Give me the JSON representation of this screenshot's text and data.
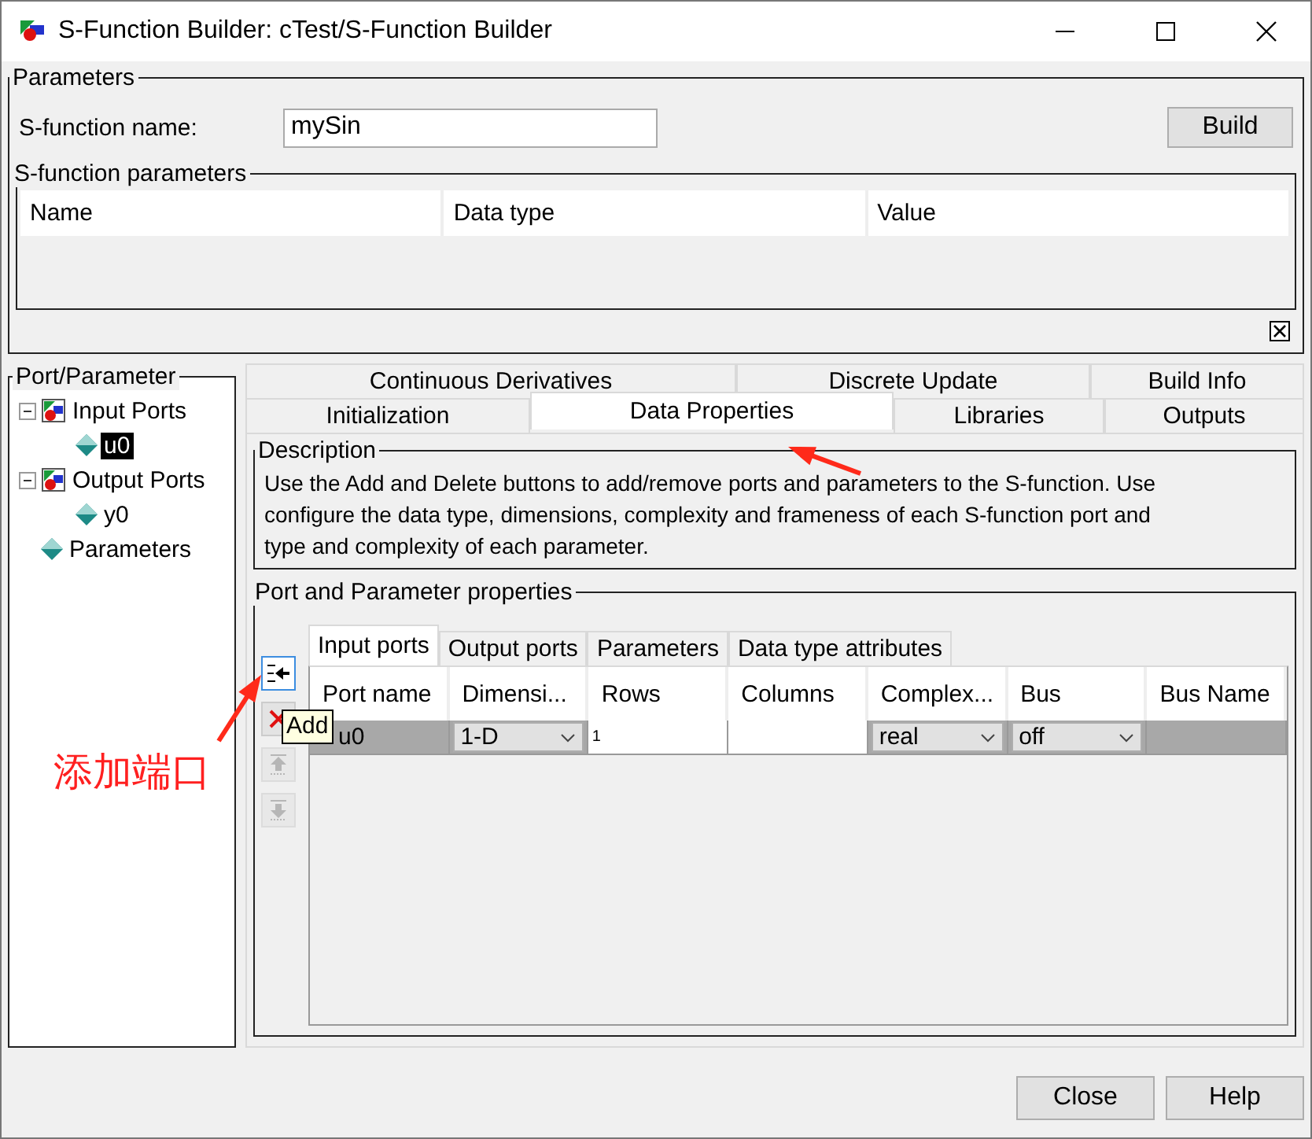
{
  "window": {
    "title": "S-Function Builder: cTest/S-Function Builder"
  },
  "parameters": {
    "title": "Parameters",
    "name_label": "S-function name:",
    "name_value": "mySin",
    "build_button": "Build",
    "sfunction_parameters": {
      "title": "S-function parameters",
      "columns": [
        "Name",
        "Data type",
        "Value"
      ]
    }
  },
  "port_tree": {
    "title": "Port/Parameter",
    "items": [
      {
        "label": "Input Ports",
        "kind": "group",
        "expanded": true,
        "selected": false,
        "children": [
          {
            "label": "u0",
            "kind": "port",
            "selected": true
          }
        ]
      },
      {
        "label": "Output Ports",
        "kind": "group",
        "expanded": true,
        "selected": false,
        "children": [
          {
            "label": "y0",
            "kind": "port",
            "selected": false
          }
        ]
      },
      {
        "label": "Parameters",
        "kind": "port",
        "selected": false
      }
    ]
  },
  "tabs": {
    "back_tabs": [
      {
        "label": "Continuous Derivatives",
        "selected": false
      },
      {
        "label": "Discrete Update",
        "selected": false
      },
      {
        "label": "Build Info",
        "selected": false
      }
    ],
    "front_tabs": [
      {
        "label": "Initialization",
        "selected": false
      },
      {
        "label": "Data Properties",
        "selected": true
      },
      {
        "label": "Libraries",
        "selected": false
      },
      {
        "label": "Outputs",
        "selected": false
      }
    ]
  },
  "description": {
    "title": "Description",
    "lines": [
      "Use the Add and Delete buttons to add/remove ports and parameters to the S-function. Use",
      "configure the data type, dimensions, complexity and frameness of each S-function port and",
      "type and complexity of each parameter."
    ]
  },
  "port_properties": {
    "title": "Port and Parameter properties",
    "side_buttons": [
      {
        "kind": "add",
        "disabled": false
      },
      {
        "kind": "delete",
        "disabled": false
      },
      {
        "kind": "up",
        "disabled": true
      },
      {
        "kind": "down",
        "disabled": true
      }
    ],
    "tooltip": "Add",
    "tabs": [
      {
        "label": "Input ports",
        "selected": true
      },
      {
        "label": "Output ports",
        "selected": false
      },
      {
        "label": "Parameters",
        "selected": false
      },
      {
        "label": "Data type attributes",
        "selected": false
      }
    ],
    "columns": [
      "Port name",
      "Dimensi...",
      "Rows",
      "Columns",
      "Complex...",
      "Bus",
      "Bus Name"
    ],
    "rows": [
      {
        "selected": true,
        "cells": [
          {
            "kind": "label",
            "value": "u0"
          },
          {
            "kind": "select",
            "value": "1-D"
          },
          {
            "kind": "input",
            "value": "1"
          },
          {
            "kind": "input"
          },
          {
            "kind": "select",
            "value": "real"
          },
          {
            "kind": "select",
            "value": "off"
          },
          {
            "kind": "label"
          }
        ]
      }
    ]
  },
  "annotation": {
    "text": "添加端口"
  },
  "buttons": [
    "Close",
    "Help"
  ]
}
